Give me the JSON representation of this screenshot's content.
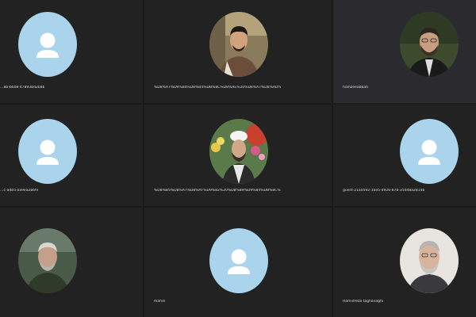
{
  "participants": [
    {
      "name": "…8b-b608-47893bd2b8b",
      "avatar": "user-placeholder"
    },
    {
      "name": "%D8%A7%D9%84%D8%B4%DB%8C%D8%AE%20%D8%A7%D8%AD%D9%85%D8%AF%20%D8%A7%D9%84%D9%84%D9%87%DB%8C…",
      "avatar": "photo"
    },
    {
      "name": "hamzeeabbati",
      "avatar": "photo"
    },
    {
      "name": "…c-adb5-aa9ea2b6fe",
      "avatar": "user-placeholder"
    },
    {
      "name": "%D8%B5%D8%A7%D8%AF%D9%82%20%D8%B9%D9%84%DB%8C%D8%B2%D8%A7%D8%AF%D9%87%20%D8%AE%D9%88%D8%B3%D9%86%DB%8C",
      "avatar": "photo"
    },
    {
      "name": "guest-21a0592-1ae5-4926-87b-35d48a2814b",
      "avatar": "user-placeholder"
    },
    {
      "name": "",
      "avatar": "photo"
    },
    {
      "name": "mahdi",
      "avatar": "user-placeholder"
    },
    {
      "name": "Hamidreza taghavaghi",
      "avatar": "photo"
    }
  ],
  "colors": {
    "background": "#1a1a1a",
    "tile": "#222222",
    "active_tile": "#2b2b2f",
    "placeholder_avatar": "#a9d4ec",
    "placeholder_figure": "#ffffff"
  }
}
